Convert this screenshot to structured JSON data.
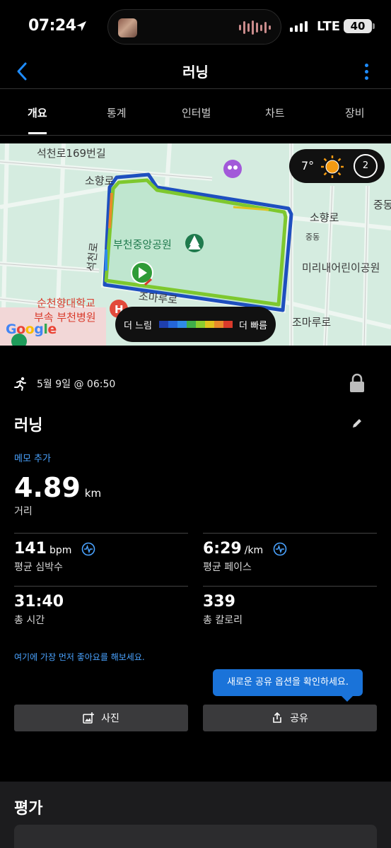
{
  "status_bar": {
    "time": "07:24",
    "network": "LTE",
    "battery": "40"
  },
  "nav": {
    "title": "러닝"
  },
  "tabs": [
    {
      "label": "개요",
      "active": true
    },
    {
      "label": "통계",
      "active": false
    },
    {
      "label": "인터벌",
      "active": false
    },
    {
      "label": "차트",
      "active": false
    },
    {
      "label": "장비",
      "active": false
    }
  ],
  "map": {
    "labels": {
      "road_seokcheon": "석천로169번길",
      "road_sohyang_left": "소향로",
      "road_sohyang_right": "소향로",
      "park": "부천중앙공원",
      "jungdong_small": "중동",
      "kids_park": "미리내어린이공원",
      "road_seokcheon_vertical": "석천로",
      "road_jomaru_left": "조마루로",
      "road_jomaru_right": "조마루로",
      "hospital_line1": "순천향대학교",
      "hospital_line2": "부속 부천병원",
      "jungdong_right": "중동"
    },
    "weather": {
      "temperature": "7°",
      "wind": "2"
    },
    "legend": {
      "slow": "더 느림",
      "fast": "더 빠름",
      "colors": [
        "#1e3fae",
        "#2466d8",
        "#2f8be8",
        "#3fae4a",
        "#8bcc2f",
        "#e0c21e",
        "#e8892b",
        "#d93a2b"
      ]
    },
    "attribution": "Google"
  },
  "activity": {
    "date": "5월 9일 @ 06:50",
    "title": "러닝",
    "add_memo": "메모 추가",
    "distance_value": "4.89",
    "distance_unit": "km",
    "distance_label": "거리",
    "stats": {
      "heart_rate": {
        "value": "141",
        "unit": "bpm",
        "label": "평균 심박수"
      },
      "pace": {
        "value": "6:29",
        "unit": "/km",
        "label": "평균 페이스"
      },
      "total_time": {
        "value": "31:40",
        "label": "총 시간"
      },
      "calories": {
        "value": "339",
        "label": "총 칼로리"
      }
    },
    "like_prompt": "여기에 가장 먼저 좋아요를 해보세요.",
    "share_tooltip": "새로운 공유 옵션을 확인하세요.",
    "photo_button": "사진",
    "share_button": "공유"
  },
  "evaluation": {
    "title": "평가"
  },
  "colors": {
    "accent": "#1e8cff",
    "link": "#4aa3ff",
    "tooltip": "#1a73d9",
    "route": "#7ec82e"
  }
}
